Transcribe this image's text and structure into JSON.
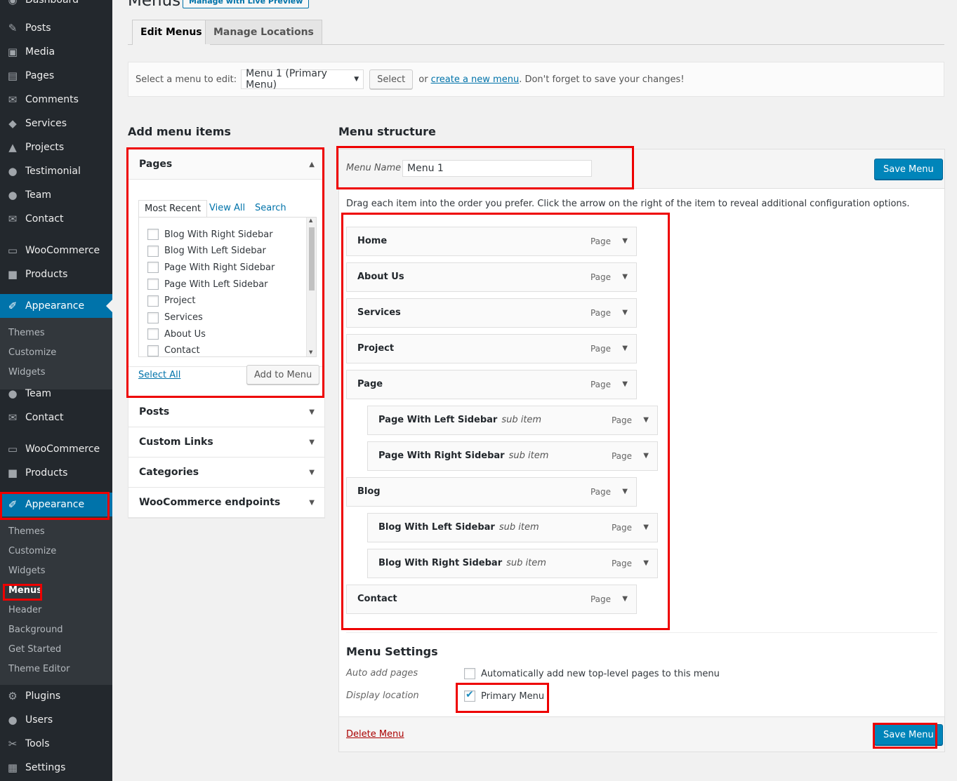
{
  "sidebar": {
    "top_items": [
      {
        "label": "Dashboard",
        "icon": "dashboard-icon",
        "glyph": "◉"
      },
      {
        "label": "Posts",
        "icon": "pin-icon",
        "glyph": "✎"
      },
      {
        "label": "Media",
        "icon": "media-icon",
        "glyph": "▣"
      },
      {
        "label": "Pages",
        "icon": "pages-icon",
        "glyph": "▤"
      },
      {
        "label": "Comments",
        "icon": "comments-icon",
        "glyph": "✉"
      },
      {
        "label": "Services",
        "icon": "tag-icon",
        "glyph": "◆"
      },
      {
        "label": "Projects",
        "icon": "projects-icon",
        "glyph": "▲"
      },
      {
        "label": "Testimonial",
        "icon": "user-icon",
        "glyph": "●"
      },
      {
        "label": "Team",
        "icon": "user-icon",
        "glyph": "●"
      },
      {
        "label": "Contact",
        "icon": "mail-icon",
        "glyph": "✉"
      },
      {
        "label": "WooCommerce",
        "icon": "woocommerce-icon",
        "glyph": "▭"
      },
      {
        "label": "Products",
        "icon": "box-icon",
        "glyph": "■"
      },
      {
        "label": "Appearance",
        "icon": "brush-icon",
        "glyph": "✐"
      }
    ],
    "sub1": [
      "Themes",
      "Customize",
      "Widgets"
    ],
    "mid_items": [
      {
        "label": "Team",
        "icon": "user-icon",
        "glyph": "●"
      },
      {
        "label": "Contact",
        "icon": "mail-icon",
        "glyph": "✉"
      },
      {
        "label": "WooCommerce",
        "icon": "woocommerce-icon",
        "glyph": "▭"
      },
      {
        "label": "Products",
        "icon": "box-icon",
        "glyph": "■"
      },
      {
        "label": "Appearance",
        "icon": "brush-icon",
        "glyph": "✐"
      }
    ],
    "sub2": [
      "Themes",
      "Customize",
      "Widgets",
      "Menus",
      "Header",
      "Background",
      "Get Started",
      "Theme Editor"
    ],
    "bottom_items": [
      {
        "label": "Plugins",
        "icon": "plugin-icon",
        "glyph": "⚙"
      },
      {
        "label": "Users",
        "icon": "users-icon",
        "glyph": "●"
      },
      {
        "label": "Tools",
        "icon": "wrench-icon",
        "glyph": "✂"
      },
      {
        "label": "Settings",
        "icon": "settings-icon",
        "glyph": "▦"
      }
    ]
  },
  "header": {
    "title": "Menus",
    "preview_button": "Manage with Live Preview",
    "tabs": [
      "Edit Menus",
      "Manage Locations"
    ]
  },
  "manage": {
    "label": "Select a menu to edit:",
    "selected": "Menu 1 (Primary Menu)",
    "select_button": "Select",
    "or": "or",
    "create_link": "create a new menu",
    "note": ". Don't forget to save your changes!"
  },
  "add_items": {
    "title": "Add menu items",
    "pages_title": "Pages",
    "inner_tabs": [
      "Most Recent",
      "View All",
      "Search"
    ],
    "pages": [
      "Blog With Right Sidebar",
      "Blog With Left Sidebar",
      "Page With Right Sidebar",
      "Page With Left Sidebar",
      "Project",
      "Services",
      "About Us",
      "Contact"
    ],
    "select_all": "Select All",
    "add_button": "Add to Menu",
    "sections": [
      "Posts",
      "Custom Links",
      "Categories",
      "WooCommerce endpoints"
    ]
  },
  "structure": {
    "title": "Menu structure",
    "name_label": "Menu Name",
    "name_value": "Menu 1",
    "save": "Save Menu",
    "instructions": "Drag each item into the order you prefer. Click the arrow on the right of the item to reveal additional configuration options.",
    "items": [
      {
        "title": "Home",
        "type": "Page",
        "sub": ""
      },
      {
        "title": "About Us",
        "type": "Page",
        "sub": ""
      },
      {
        "title": "Services",
        "type": "Page",
        "sub": ""
      },
      {
        "title": "Project",
        "type": "Page",
        "sub": ""
      },
      {
        "title": "Page",
        "type": "Page",
        "sub": ""
      },
      {
        "title": "Page With Left Sidebar",
        "type": "Page",
        "sub": "sub item"
      },
      {
        "title": "Page With Right Sidebar",
        "type": "Page",
        "sub": "sub item"
      },
      {
        "title": "Blog",
        "type": "Page",
        "sub": ""
      },
      {
        "title": "Blog With Left Sidebar",
        "type": "Page",
        "sub": "sub item"
      },
      {
        "title": "Blog With Right Sidebar",
        "type": "Page",
        "sub": "sub item"
      },
      {
        "title": "Contact",
        "type": "Page",
        "sub": ""
      }
    ]
  },
  "settings": {
    "title": "Menu Settings",
    "auto_label": "Auto add pages",
    "auto_text": "Automatically add new top-level pages to this menu",
    "location_label": "Display location",
    "location_text": "Primary Menu",
    "delete": "Delete Menu",
    "save": "Save Menu"
  },
  "colors": {
    "accent": "#0073aa",
    "highlight": "#e00000",
    "primary_button": "#0085ba"
  }
}
